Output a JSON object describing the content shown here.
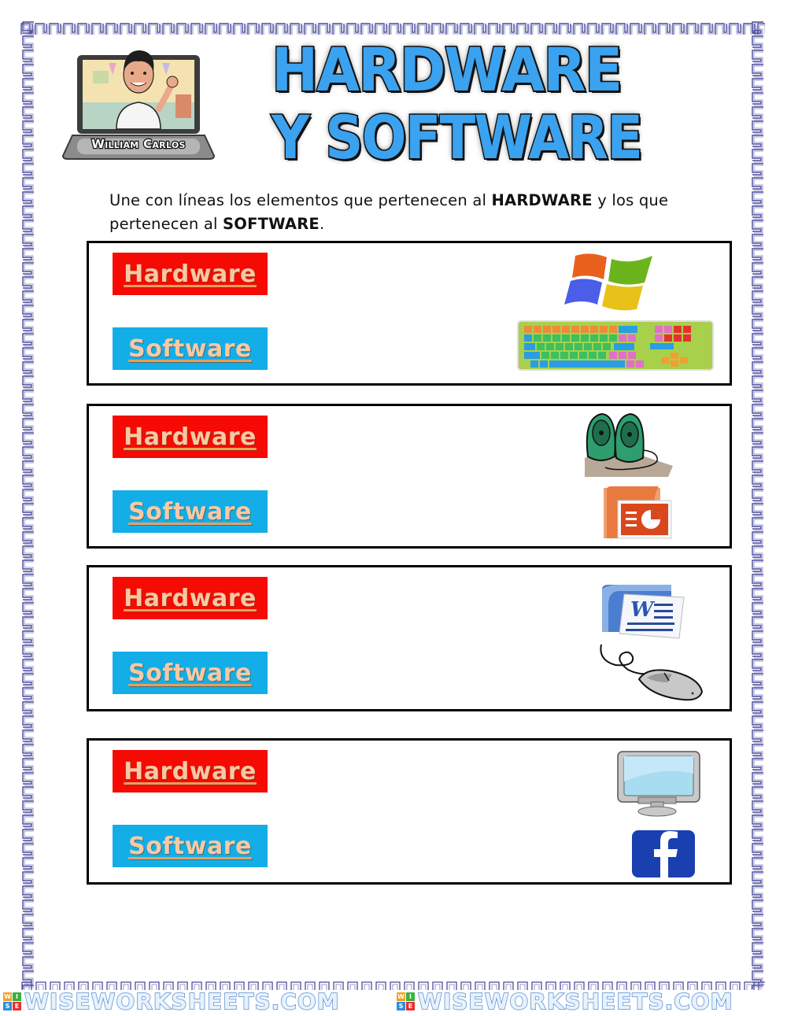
{
  "header": {
    "avatar_caption": "William Carlos",
    "title_line1": "HARDWARE",
    "title_line2": "Y SOFTWARE"
  },
  "instructions": {
    "part1": "Une con líneas los elementos que pertenecen al ",
    "bold1": "HARDWARE",
    "part2": " y los que pertenecen al ",
    "bold2": "SOFTWARE",
    "part3": "."
  },
  "colors": {
    "hardware_bg": "#f60a04",
    "software_bg": "#13aee8",
    "label_text": "#f6c9a4",
    "title_blue": "#3aa2ef",
    "border_blue": "#4a4a9a"
  },
  "groups": [
    {
      "hardware_label": "Hardware",
      "software_label": "Software",
      "images": [
        "windows-logo",
        "keyboard"
      ]
    },
    {
      "hardware_label": "Hardware",
      "software_label": "Software",
      "images": [
        "speakers",
        "powerpoint-logo"
      ]
    },
    {
      "hardware_label": "Hardware",
      "software_label": "Software",
      "images": [
        "word-logo",
        "mouse"
      ]
    },
    {
      "hardware_label": "Hardware",
      "software_label": "Software",
      "images": [
        "monitor",
        "facebook-logo"
      ]
    }
  ],
  "footer": {
    "watermark": "WISEWORKSHEETS.COM",
    "logo_letters": [
      "W",
      "I",
      "S",
      "E"
    ]
  }
}
